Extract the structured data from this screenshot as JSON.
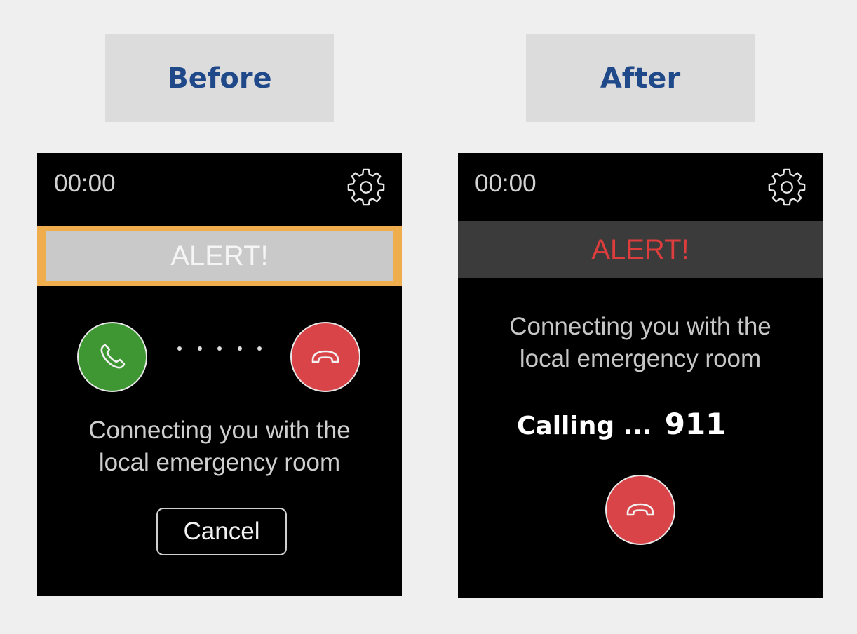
{
  "before": {
    "heading": "Before",
    "screen": {
      "time": "00:00",
      "alert_label": "ALERT!",
      "message_line1": "Connecting you with the",
      "message_line2": "local emergency room",
      "cancel_label": "Cancel",
      "icons": {
        "settings": "gear-icon",
        "accept": "phone-icon",
        "decline": "hang-up-icon"
      }
    }
  },
  "after": {
    "heading": "After",
    "screen": {
      "time": "00:00",
      "alert_label": "ALERT!",
      "message_line1": "Connecting you with the",
      "message_line2": "local emergency room",
      "calling_label": "Calling ...",
      "calling_number": "911",
      "icons": {
        "settings": "gear-icon",
        "decline": "hang-up-icon"
      }
    }
  },
  "colors": {
    "page_background": "#efefef",
    "heading_box": "#dcdcdc",
    "heading_text": "#20498a",
    "alert_highlight": "#f0ad4e",
    "alert_red": "#dd3d3d",
    "accept_green": "#3f9733",
    "decline_red": "#d94448"
  }
}
